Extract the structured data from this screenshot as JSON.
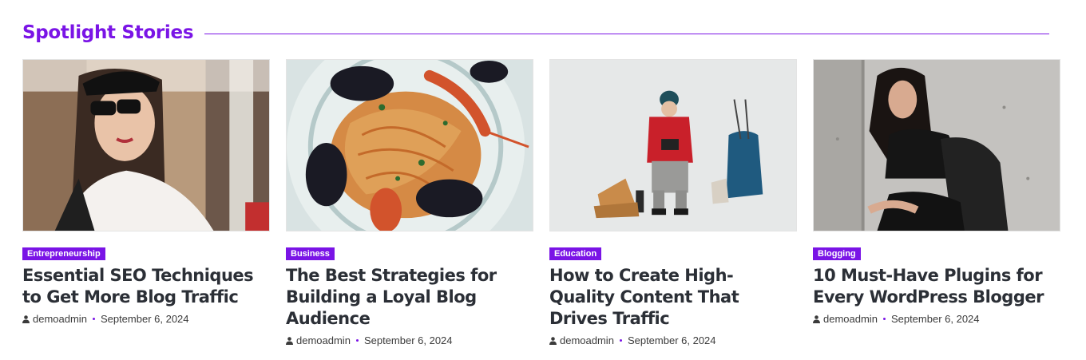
{
  "section": {
    "title": "Spotlight Stories",
    "accent_color": "#7a14e6"
  },
  "posts": [
    {
      "category": "Entrepreneurship",
      "title": "Essential SEO Techniques to Get More Blog Traffic",
      "author": "demoadmin",
      "date": "September 6, 2024",
      "image": "woman-in-sunglasses-street-photo"
    },
    {
      "category": "Business",
      "title": "The Best Strategies for Building a Loyal Blog Audience",
      "author": "demoadmin",
      "date": "September 6, 2024",
      "image": "seafood-pasta-plate-photo"
    },
    {
      "category": "Education",
      "title": "How to Create High-Quality Content That Drives Traffic",
      "author": "demoadmin",
      "date": "September 6, 2024",
      "image": "hiker-with-camera-and-backpack-photo"
    },
    {
      "category": "Blogging",
      "title": "10 Must-Have Plugins for Every WordPress Blogger",
      "author": "demoadmin",
      "date": "September 6, 2024",
      "image": "woman-leather-jacket-concrete-wall-photo"
    }
  ]
}
